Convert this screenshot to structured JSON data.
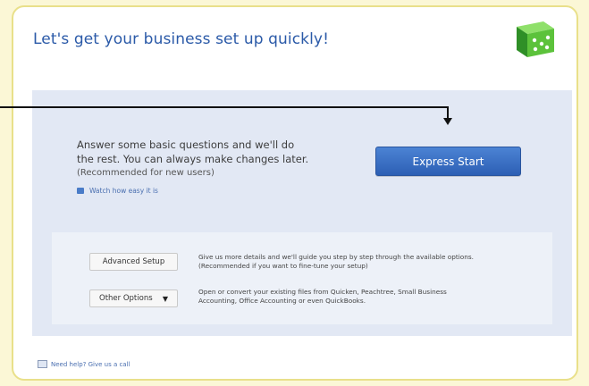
{
  "title": "Let's get your business set up quickly!",
  "logo": {
    "icon": "dice-cube-icon",
    "color_primary": "#5cc23b",
    "color_dark": "#2f8f27"
  },
  "express": {
    "description_line1": "Answer some basic questions and we'll do",
    "description_line2": "the rest. You can always make changes later.",
    "recommendation": "(Recommended for new users)",
    "watch_link": "Watch how easy it is",
    "button_label": "Express Start",
    "button_color": "#3c71c4"
  },
  "advanced": {
    "button_label": "Advanced Setup",
    "description_line1": "Give us more details and we'll guide you step by step through the available options.",
    "description_line2": "(Recommended if you want to fine-tune your setup)"
  },
  "other": {
    "button_label": "Other Options",
    "caret_icon": "▼",
    "description_line1": "Open or convert your existing files from Quicken, Peachtree, Small Business",
    "description_line2": "Accounting, Office Accounting or even QuickBooks."
  },
  "help": {
    "label": "Need help? Give us a call"
  }
}
